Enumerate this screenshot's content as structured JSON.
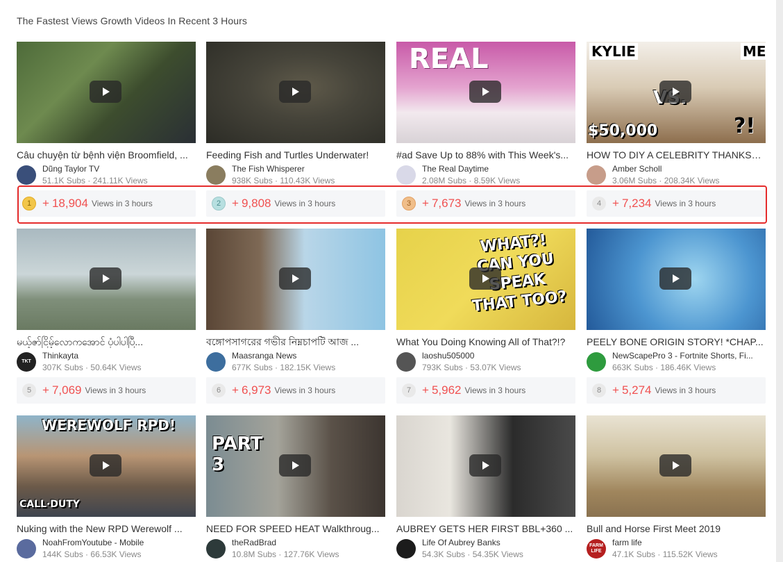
{
  "heading": "The Fastest Views Growth Videos In Recent 3 Hours",
  "views_suffix": "Views in 3 hours",
  "play_icon": "play-icon",
  "videos": [
    {
      "rank": "1",
      "title": "Câu chuyện từ bệnh viện Broomfield, ...",
      "channel": "Dũng Taylor TV",
      "subs": "51.1K Subs",
      "views": "241.11K Views",
      "growth": "18,904",
      "scene": "interview",
      "avatar_color": "#3a4f7a"
    },
    {
      "rank": "2",
      "title": "Feeding Fish and Turtles Underwater!",
      "channel": "The Fish Whisperer",
      "subs": "938K Subs",
      "views": "110.43K Views",
      "growth": "9,808",
      "scene": "underwater",
      "avatar_color": "#8a7d5f"
    },
    {
      "rank": "3",
      "title": "#ad Save Up to 88% with This Week's...",
      "channel": "The Real Daytime",
      "subs": "2.08M Subs",
      "views": "8.59K Views",
      "growth": "7,673",
      "scene": "studio",
      "avatar_color": "#d9d9e8",
      "overlay": "REAL"
    },
    {
      "rank": "4",
      "title": "HOW TO DIY A CELEBRITY THANKSG...",
      "channel": "Amber Scholl",
      "subs": "3.06M Subs",
      "views": "208.34K Views",
      "growth": "7,234",
      "scene": "kylie",
      "avatar_color": "#c79d8a",
      "overlay": "KYLIE",
      "overlay2": "ME",
      "overlay3": "VS.",
      "overlay4": "$50,000",
      "overlay5": "?!"
    },
    {
      "rank": "5",
      "title": "မယ့်ဇာ်ငြိမ့်လောကအောင် ပုံပါပါပြီ...",
      "channel": "Thinkayta",
      "subs": "307K Subs",
      "views": "50.64K Views",
      "growth": "7,069",
      "scene": "lake",
      "avatar_color": "#222222",
      "avatar_text": "TKT"
    },
    {
      "rank": "6",
      "title": "বঙ্গোপসাগরের গভীর নিম্নচাপটি আজ ...",
      "channel": "Maasranga News",
      "subs": "677K Subs",
      "views": "182.15K Views",
      "growth": "6,973",
      "scene": "map",
      "avatar_color": "#3d6e9e"
    },
    {
      "rank": "7",
      "title": "What You Doing Knowing All of That?!?",
      "channel": "laoshu505000",
      "subs": "793K Subs",
      "views": "53.07K Views",
      "growth": "5,962",
      "scene": "speak",
      "avatar_color": "#555555",
      "overlay": "WHAT?! CAN YOU SPEAK THAT TOO?"
    },
    {
      "rank": "8",
      "title": "PEELY BONE ORIGIN STORY! *CHAP...",
      "channel": "NewScapePro 3 - Fortnite Shorts, Fi...",
      "subs": "663K Subs",
      "views": "186.46K Views",
      "growth": "5,274",
      "scene": "peely",
      "avatar_color": "#2e9b3e"
    },
    {
      "rank": "",
      "title": "Nuking with the New RPD Werewolf ...",
      "channel": "NoahFromYoutube - Mobile",
      "subs": "144K Subs",
      "views": "66.53K Views",
      "growth": "",
      "scene": "cod",
      "avatar_color": "#5a6b9e",
      "overlay": "WEREWOLF RPD!",
      "overlay2": "CALL·DUTY"
    },
    {
      "rank": "",
      "title": "NEED FOR SPEED HEAT Walkthroug...",
      "channel": "theRadBrad",
      "subs": "10.8M Subs",
      "views": "127.76K Views",
      "growth": "",
      "scene": "part3",
      "avatar_color": "#2d3a3a",
      "overlay": "PART 3"
    },
    {
      "rank": "",
      "title": "AUBREY GETS HER FIRST BBL+360 ...",
      "channel": "Life Of Aubrey Banks",
      "subs": "54.3K Subs",
      "views": "54.35K Views",
      "growth": "",
      "scene": "aubrey",
      "avatar_color": "#1c1c1c"
    },
    {
      "rank": "",
      "title": "Bull and Horse First Meet 2019",
      "channel": "farm life",
      "subs": "47.1K Subs",
      "views": "115.52K Views",
      "growth": "",
      "scene": "farm",
      "avatar_color": "#b51f1f",
      "avatar_text": "FARM LIFE"
    }
  ]
}
